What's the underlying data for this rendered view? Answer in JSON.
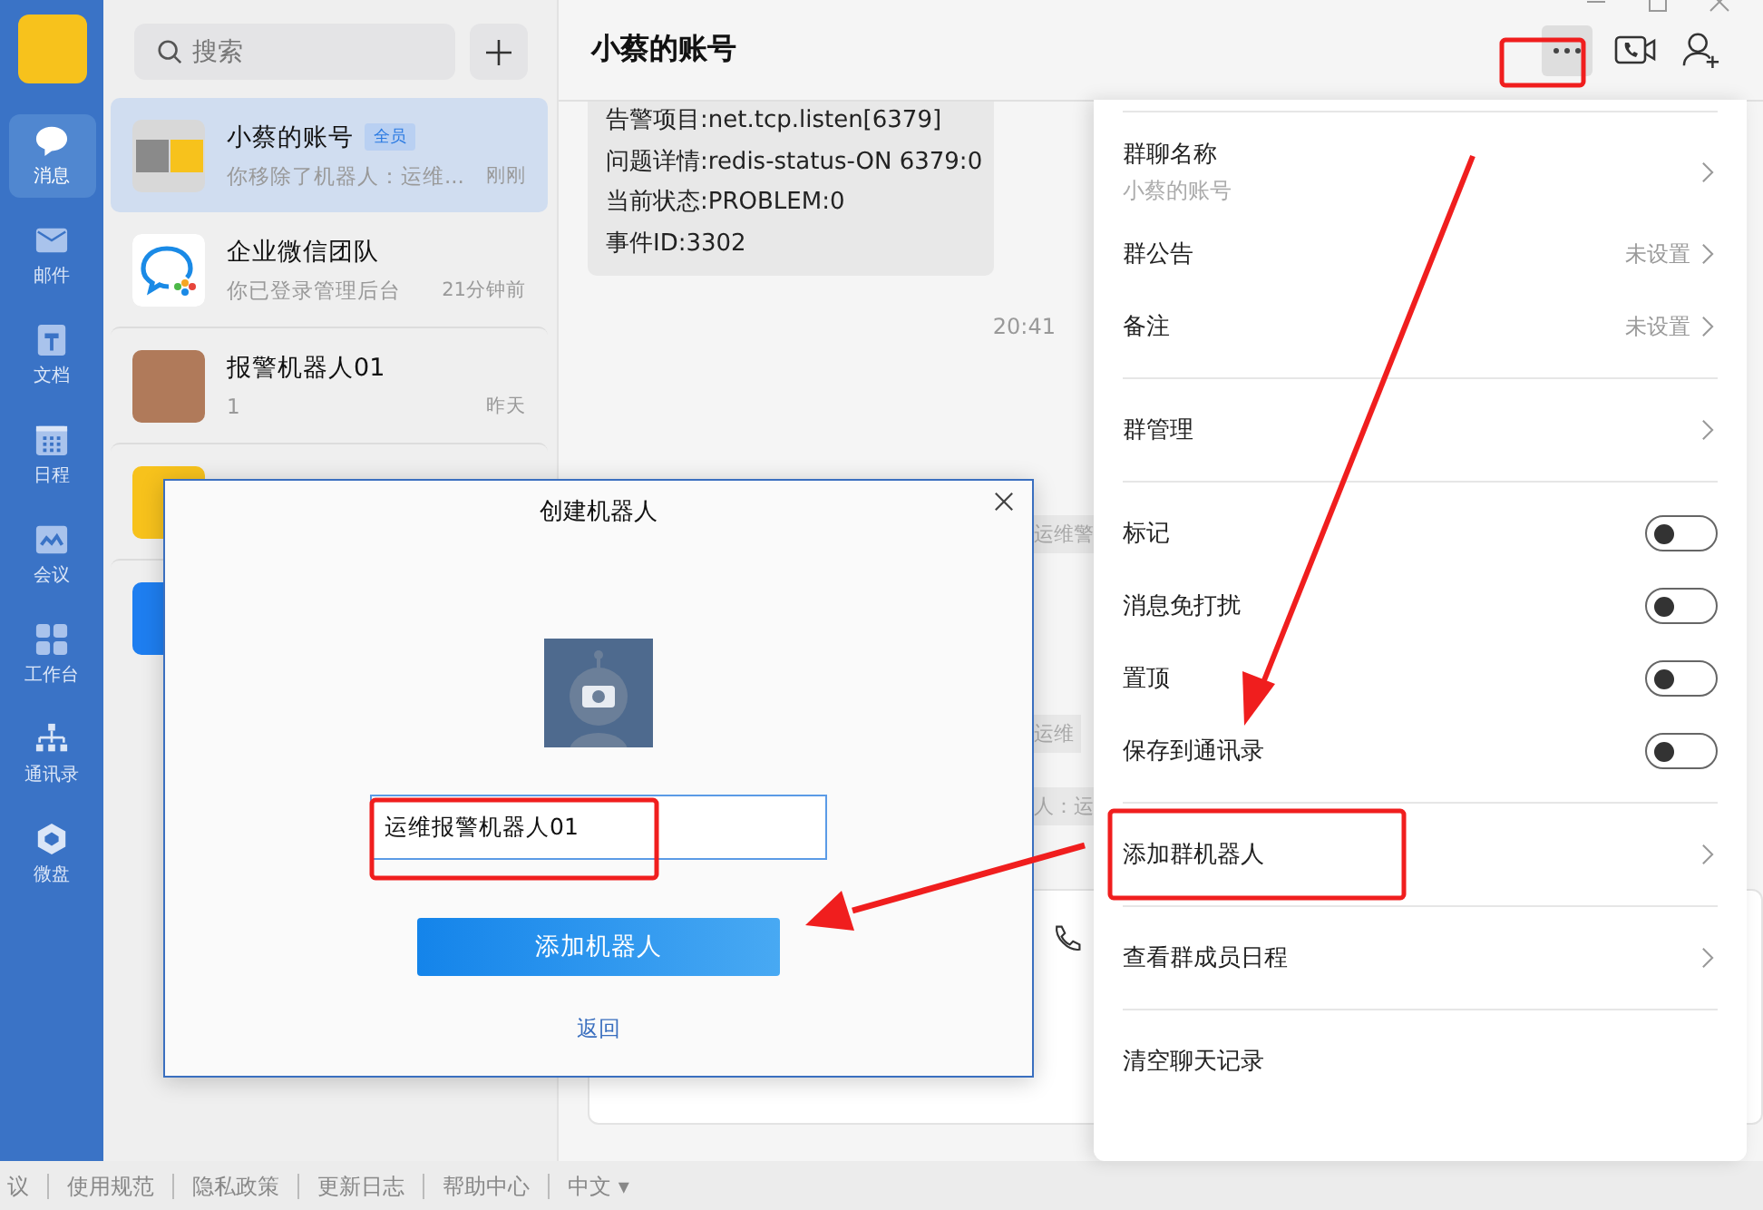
{
  "rail": {
    "items": [
      {
        "label": "消息",
        "selected": true
      },
      {
        "label": "邮件",
        "selected": false
      },
      {
        "label": "文档",
        "selected": false
      },
      {
        "label": "日程",
        "selected": false
      },
      {
        "label": "会议",
        "selected": false
      },
      {
        "label": "工作台",
        "selected": false
      },
      {
        "label": "通讯录",
        "selected": false
      },
      {
        "label": "微盘",
        "selected": false
      }
    ]
  },
  "chat_list": {
    "search": {
      "placeholder": "搜索"
    },
    "items": [
      {
        "name": "小蔡的账号",
        "badge": "全员",
        "preview": "你移除了机器人：运维...",
        "time": "刚刚",
        "selected": true
      },
      {
        "name": "企业微信团队",
        "preview": "你已登录管理后台",
        "time": "21分钟前",
        "selected": false
      },
      {
        "name": "报警机器人01",
        "preview": "1",
        "time": "昨天",
        "selected": false
      },
      {
        "selected": false
      },
      {
        "selected": false
      }
    ]
  },
  "chat": {
    "title": "小蔡的账号",
    "message_lines": [
      "告警项目:net.tcp.listen[6379]",
      "问题详情:redis-status-ON 6379:0",
      "当前状态:PROBLEM:0",
      "事件ID:3302"
    ],
    "time": "20:41",
    "partial_bubbles": [
      "运维警",
      "运维",
      "人：运"
    ]
  },
  "settings_panel": {
    "sections": [
      [
        {
          "kind": "nav",
          "label": "群聊名称",
          "subtitle": "小蔡的账号"
        },
        {
          "kind": "nav",
          "label": "群公告",
          "value": "未设置"
        },
        {
          "kind": "nav",
          "label": "备注",
          "value": "未设置"
        }
      ],
      [
        {
          "kind": "nav",
          "label": "群管理"
        }
      ],
      [
        {
          "kind": "toggle",
          "label": "标记",
          "on": false
        },
        {
          "kind": "toggle",
          "label": "消息免打扰",
          "on": false
        },
        {
          "kind": "toggle",
          "label": "置顶",
          "on": false
        },
        {
          "kind": "toggle",
          "label": "保存到通讯录",
          "on": false
        }
      ],
      [
        {
          "kind": "nav",
          "label": "添加群机器人"
        }
      ],
      [
        {
          "kind": "nav",
          "label": "查看群成员日程"
        }
      ],
      [
        {
          "kind": "action",
          "label": "清空聊天记录"
        }
      ]
    ]
  },
  "dialog": {
    "title": "创建机器人",
    "name_input": {
      "value": "运维报警机器人01"
    },
    "submit": "添加机器人",
    "back": "返回"
  },
  "footer": {
    "links": [
      "议",
      "使用规范",
      "隐私政策",
      "更新日志",
      "帮助中心"
    ],
    "language": "中文",
    "caret": "▾"
  }
}
